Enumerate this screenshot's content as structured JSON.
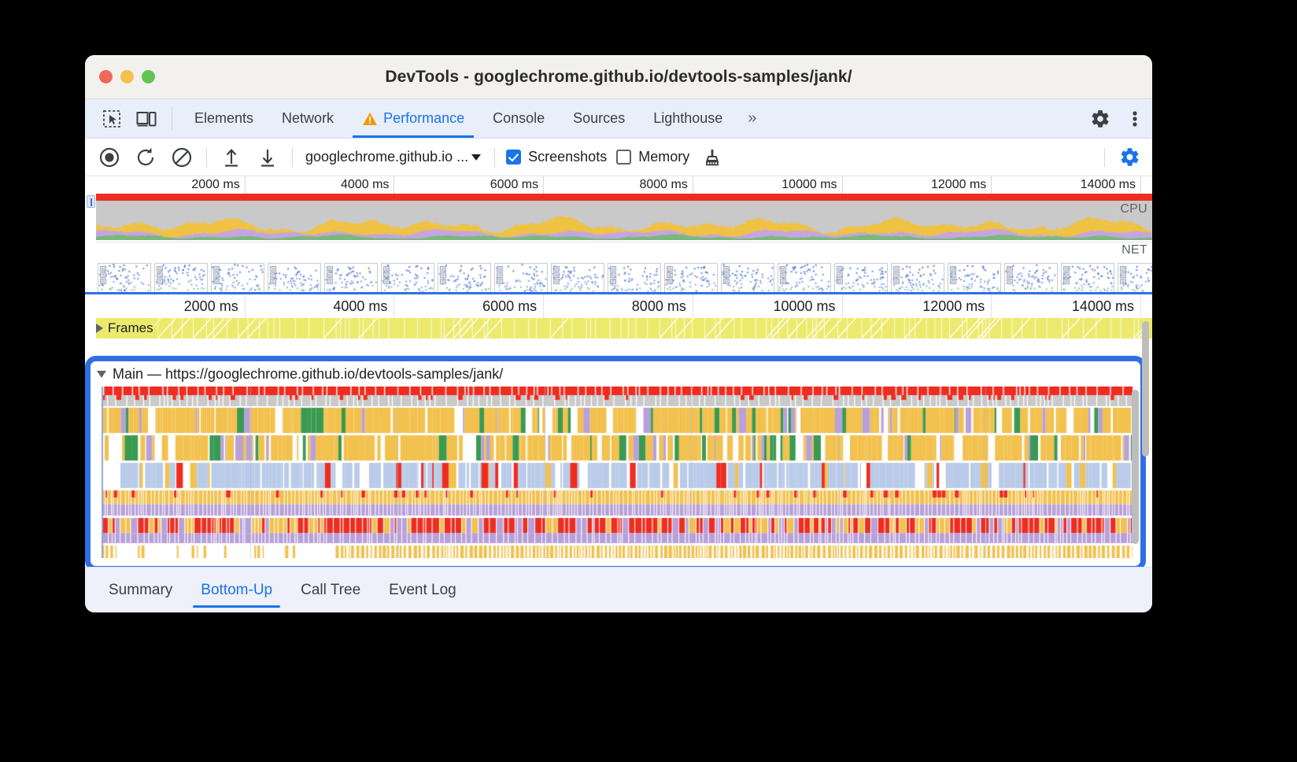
{
  "window": {
    "title": "DevTools - googlechrome.github.io/devtools-samples/jank/",
    "traffic": {
      "close": "close-button",
      "minimize": "minimize-button",
      "zoom": "zoom-button"
    }
  },
  "panel_tabs": {
    "items": [
      {
        "label": "Elements",
        "active": false
      },
      {
        "label": "Network",
        "active": false
      },
      {
        "label": "Performance",
        "active": true,
        "warning": true
      },
      {
        "label": "Console",
        "active": false
      },
      {
        "label": "Sources",
        "active": false
      },
      {
        "label": "Lighthouse",
        "active": false
      }
    ],
    "more": "»",
    "settings_icon": "gear-icon",
    "menu_icon": "kebab-menu-icon"
  },
  "toolbar": {
    "record_icon": "record-button",
    "reload_icon": "reload-and-record-button",
    "clear_icon": "clear-recording-button",
    "upload_icon": "load-profile-button",
    "download_icon": "save-profile-button",
    "url_select": "googlechrome.github.io ...",
    "screenshots": {
      "label": "Screenshots",
      "checked": true
    },
    "memory": {
      "label": "Memory",
      "checked": false
    },
    "garbage_icon": "collect-garbage-button",
    "capture_settings_icon": "capture-settings-gear-icon"
  },
  "overview": {
    "ticks": [
      "2000 ms",
      "4000 ms",
      "6000 ms",
      "8000 ms",
      "10000 ms",
      "12000 ms",
      "14000 ms"
    ],
    "cpu_label": "CPU",
    "net_label": "NET",
    "frames_count": 20
  },
  "timeline": {
    "ticks": [
      "2000 ms",
      "4000 ms",
      "6000 ms",
      "8000 ms",
      "10000 ms",
      "12000 ms",
      "14000 ms"
    ],
    "frames_label": "Frames",
    "main_label": "Main — https://googlechrome.github.io/devtools-samples/jank/",
    "highlight_color": "#2f6fe4"
  },
  "bottom_tabs": {
    "items": [
      {
        "label": "Summary",
        "active": false
      },
      {
        "label": "Bottom-Up",
        "active": true
      },
      {
        "label": "Call Tree",
        "active": false
      },
      {
        "label": "Event Log",
        "active": false
      }
    ]
  },
  "colors": {
    "accent": "#1a73e8",
    "highlight": "#2f6fe4",
    "scripting": "#f2c14e",
    "rendering": "#b8a0d9",
    "painting": "#7fbf7f",
    "loading": "#b9cbe8",
    "long_task": "#ee2d21",
    "idle": "#c9c9c9",
    "frames": "#ecea6c"
  }
}
